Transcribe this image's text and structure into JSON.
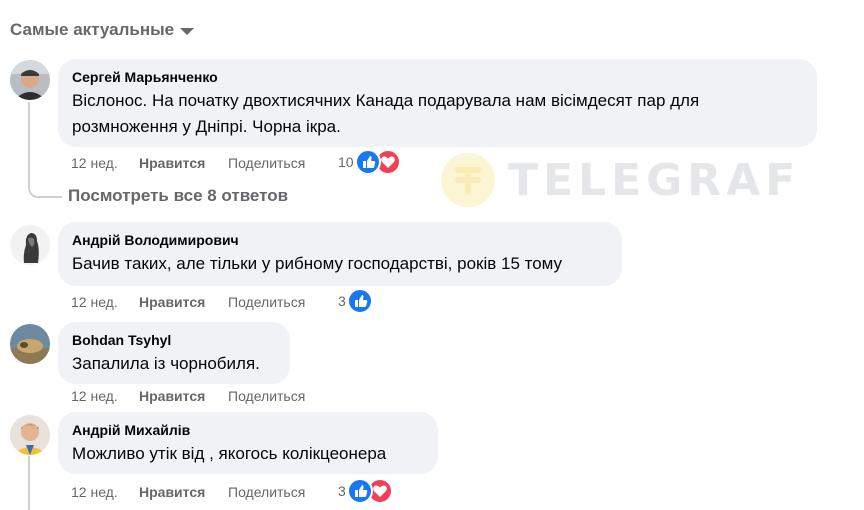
{
  "sort_label": "Самые актуальные",
  "watermark_text": "TELEGRAF",
  "view_replies": "Посмотреть все 8 ответов",
  "comments": [
    {
      "author": "Сергей Марьянченко",
      "lines": [
        "Віслонос. На початку двохтисячних Канада подарувала нам вісімдесят пар для",
        "розмноження у Дніпрі. Чорна ікра."
      ],
      "time": "12 нед.",
      "like": "Нравится",
      "share": "Поделиться",
      "reaction_count": "10",
      "reactions": [
        "like-icon",
        "love-icon"
      ]
    },
    {
      "author": "Андрій Володимирович",
      "lines": [
        "Бачив таких, але тільки у рибному господарстві, років 15 тому"
      ],
      "time": "12 нед.",
      "like": "Нравится",
      "share": "Поделиться",
      "reaction_count": "3",
      "reactions": [
        "like-icon"
      ]
    },
    {
      "author": "Bohdan Tsyhyl",
      "lines": [
        "Запалила із чорнобиля."
      ],
      "time": "12 нед.",
      "like": "Нравится",
      "share": "Поделиться",
      "reaction_count": "",
      "reactions": []
    },
    {
      "author": "Андрій Михайлів",
      "lines": [
        "Можливо утік від , якогось колікцеонера"
      ],
      "time": "12 нед.",
      "like": "Нравится",
      "share": "Поделиться",
      "reaction_count": "3",
      "reactions": [
        "like-icon",
        "love-icon"
      ]
    }
  ],
  "colors": {
    "bubble": "#f0f2f5",
    "muted_text": "#65676b",
    "like_blue": "#1877f2",
    "love_red": "#f33e58"
  }
}
